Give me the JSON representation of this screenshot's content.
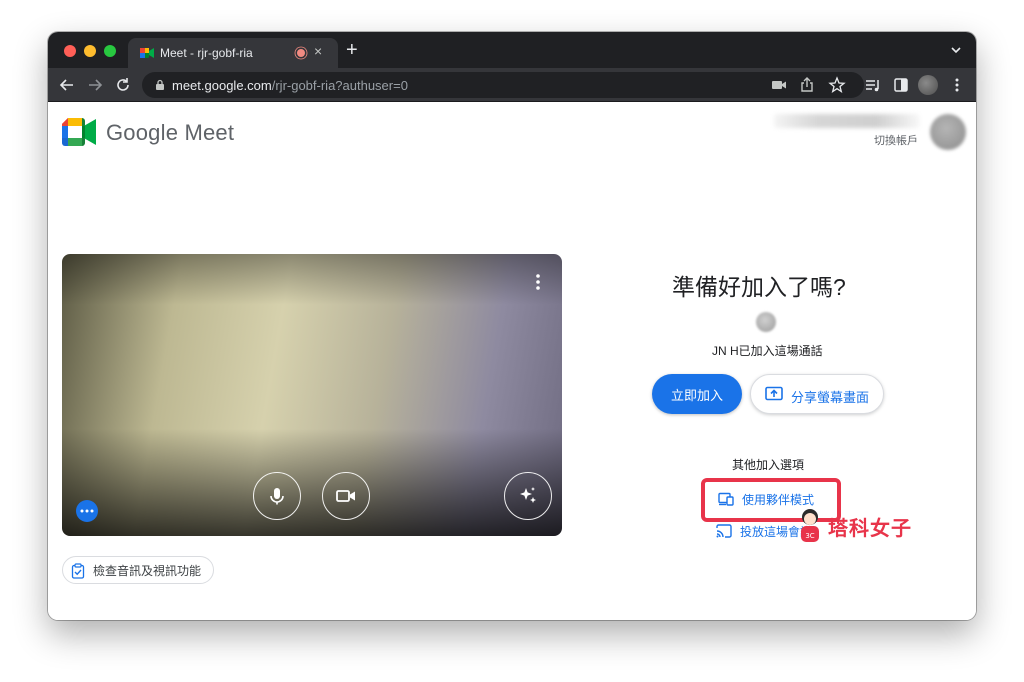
{
  "browser": {
    "tab": {
      "title": "Meet - rjr-gobf-ria",
      "close_glyph": "×",
      "recording_indicator_color": "#f28b82"
    },
    "new_tab_glyph": "+",
    "url": {
      "host": "meet.google.com",
      "path": "/rjr-gobf-ria?authuser=0"
    }
  },
  "header": {
    "brand": "Google Meet",
    "switch_account": "切換帳戶"
  },
  "preview": {
    "controls": [
      "more-options-icon",
      "microphone-icon",
      "camera-icon",
      "visual-effects-icon",
      "effects-menu-icon"
    ]
  },
  "check_av": {
    "label": "檢查音訊及視訊功能"
  },
  "join_panel": {
    "title": "準備好加入了嗎?",
    "participant_status": "JN H已加入這場通話",
    "join_now": "立即加入",
    "present": "分享螢幕畫面",
    "other_options_heading": "其他加入選項",
    "companion_mode": "使用夥伴模式",
    "cast_meeting": "投放這場會議"
  },
  "watermark": {
    "text": "塔科女子"
  },
  "colors": {
    "accent": "#1a73e8",
    "highlight": "#e8344a",
    "tabstrip": "#1f2023",
    "toolbar": "#35363a"
  }
}
